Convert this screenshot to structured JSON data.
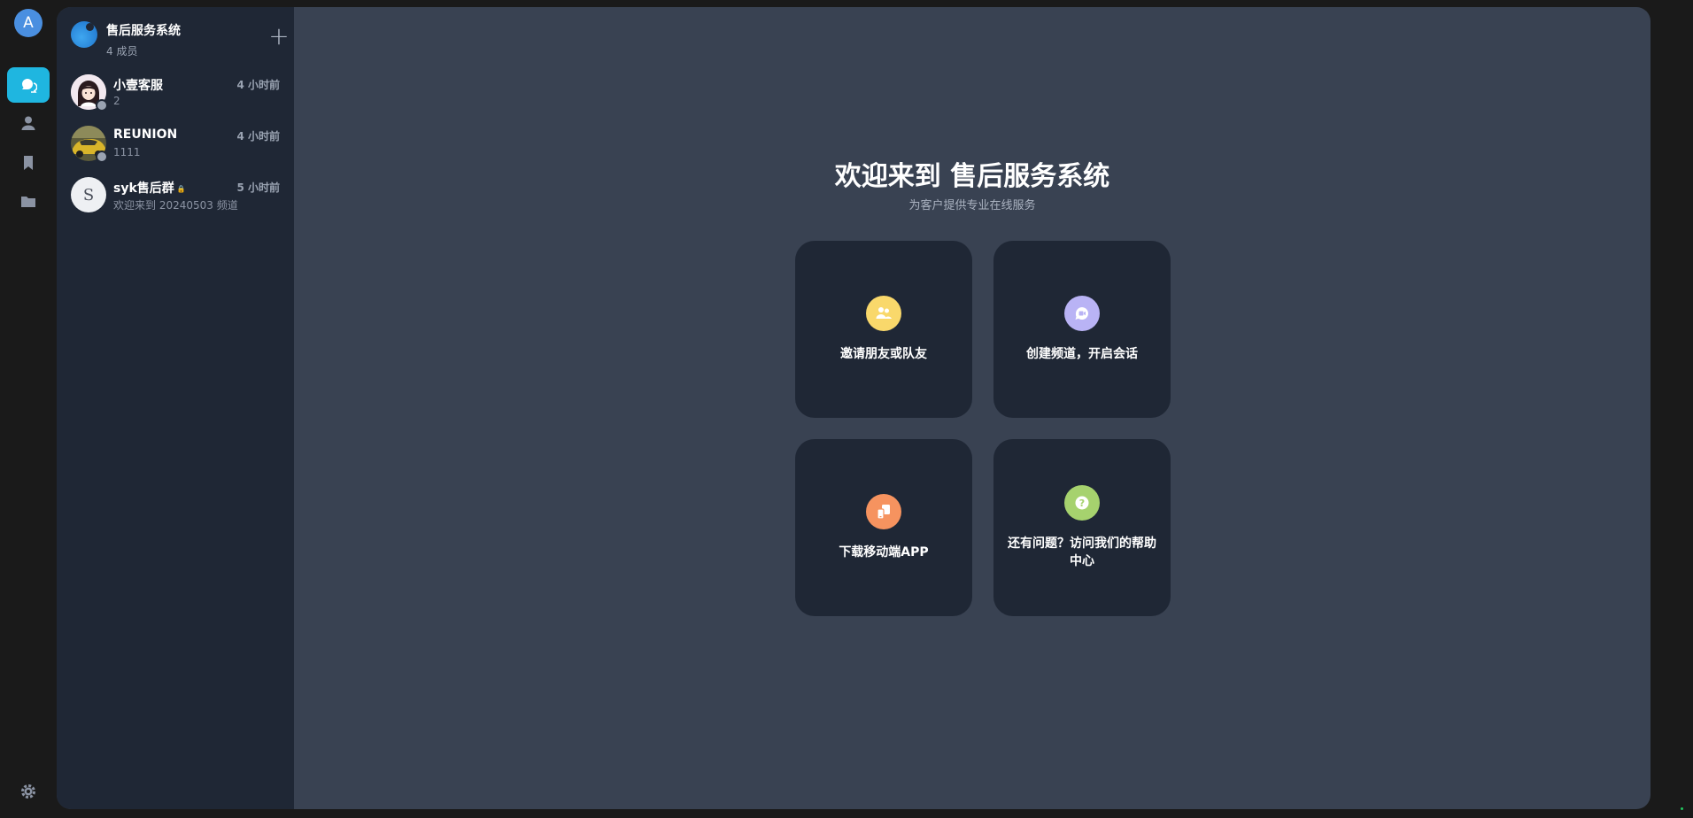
{
  "rail": {
    "user_initial": "A",
    "icons": [
      "chat-icon",
      "contacts-icon",
      "bookmark-icon",
      "folder-icon",
      "settings-icon"
    ]
  },
  "group": {
    "name": "售后服务系统",
    "members": "4 成员"
  },
  "conversations": [
    {
      "name": "小壹客服",
      "time": "4 小时前",
      "last_message": "2",
      "avatar": "girl-avatar"
    },
    {
      "name": "REUNION",
      "time": "4 小时前",
      "last_message": "1111",
      "avatar": "car-avatar"
    },
    {
      "name": "syk售后群",
      "time": "5 小时前",
      "last_message": "欢迎来到 20240503 频道",
      "avatar_initial": "S",
      "locked": true
    }
  ],
  "welcome": {
    "title": "欢迎来到 售后服务系统",
    "subtitle": "为客户提供专业在线服务"
  },
  "cards": [
    {
      "label": "邀请朋友或队友",
      "icon": "invite-friends-icon",
      "color": "#f9d86b"
    },
    {
      "label": "创建频道，开启会话",
      "icon": "create-channel-icon",
      "color": "#b9b3f5"
    },
    {
      "label": "下载移动端APP",
      "icon": "mobile-app-icon",
      "color": "#f6935f"
    },
    {
      "label": "还有问题？访问我们的帮助中心",
      "icon": "help-icon",
      "color": "#a6d26e"
    }
  ],
  "colors": {
    "accent": "#1fb6e0",
    "panel": "#394252",
    "sidebar": "#1f2735"
  }
}
